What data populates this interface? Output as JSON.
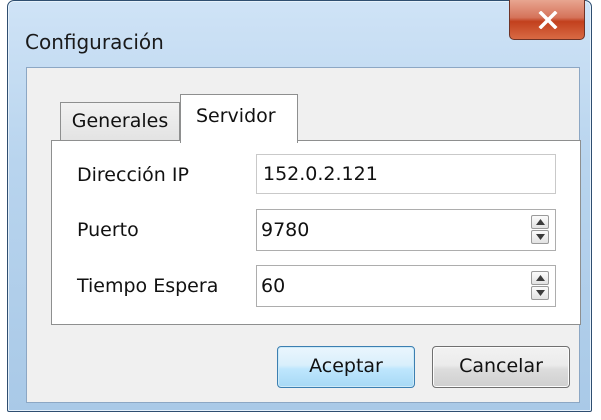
{
  "window": {
    "title": "Configuración",
    "close_icon": "close-x-icon"
  },
  "tabs": [
    {
      "label": "Generales",
      "selected": false
    },
    {
      "label": "Servidor",
      "selected": true
    }
  ],
  "form": {
    "ip_label": "Dirección IP",
    "ip_value": "152.0.2.121",
    "port_label": "Puerto",
    "port_value": "9780",
    "timeout_label": "Tiempo Espera",
    "timeout_value": "60"
  },
  "buttons": {
    "ok_label": "Aceptar",
    "cancel_label": "Cancelar"
  },
  "colors": {
    "title_bar": "#b8d4ee",
    "close_button": "#c2401d",
    "default_button_border": "#3c7fb1"
  }
}
